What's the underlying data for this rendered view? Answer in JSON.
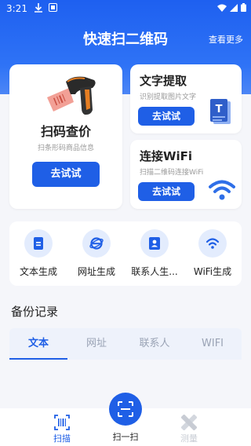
{
  "status": {
    "time": "3:21"
  },
  "header": {
    "title": "快速扫二维码",
    "more": "查看更多"
  },
  "cards": {
    "scan": {
      "title": "扫码查价",
      "subtitle": "扫条形码商品信息",
      "button": "去试试"
    },
    "text": {
      "title": "文字提取",
      "subtitle": "识别提取图片文字",
      "button": "去试试",
      "badge": "T"
    },
    "wifi": {
      "title": "连接WiFi",
      "subtitle": "扫描二维码连接WiFi",
      "button": "去试试"
    }
  },
  "shortcuts": [
    {
      "label": "文本生成",
      "icon": "document-icon"
    },
    {
      "label": "网址生成",
      "icon": "browser-icon"
    },
    {
      "label": "联系人生...",
      "icon": "contact-icon"
    },
    {
      "label": "WiFi生成",
      "icon": "wifi-icon"
    }
  ],
  "backup": {
    "title": "备份记录",
    "tabs": [
      "文本",
      "网址",
      "联系人",
      "WIFI"
    ],
    "active_tab": 0
  },
  "nav": {
    "scan": "扫描",
    "center": "扫一扫",
    "measure": "测量"
  },
  "colors": {
    "primary": "#1f5fe6",
    "header": "#2f73f6"
  }
}
